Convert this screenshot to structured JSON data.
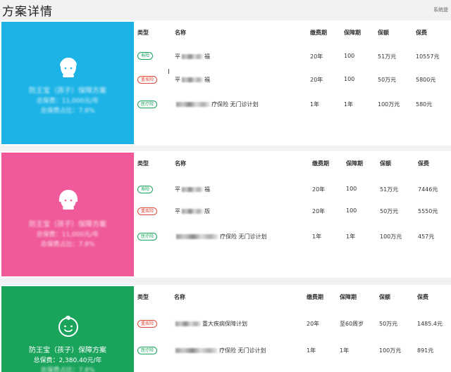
{
  "page": {
    "title": "方案详情",
    "corner": "系统提"
  },
  "columns": [
    "类型",
    "名称",
    "缴费期",
    "保障期",
    "保额",
    "保费"
  ],
  "cards": [
    {
      "panel": {
        "icon": "man-face-icon",
        "color": "#1db3e6",
        "line1": "防王宝（孩子）保障方案",
        "line2": "总保费：11,000元/年",
        "line3": "总保费占比：7.8%"
      },
      "rows": [
        {
          "type": "寿险",
          "type_class": "life",
          "name_pre": "平",
          "name_post": "福",
          "pay": "20年",
          "term": "100",
          "amount": "51万元",
          "premium": "10557元"
        },
        {
          "type": "重疾险",
          "type_class": "ci",
          "name_pre": "平",
          "name_post": "福",
          "pay": "20年",
          "term": "100",
          "amount": "50万元",
          "premium": "5800元"
        },
        {
          "type": "医疗险",
          "type_class": "med",
          "name_pre": "",
          "name_post": "疗保险 无门诊计划",
          "pay": "1年",
          "term": "1年",
          "amount": "100万元",
          "premium": "580元"
        }
      ]
    },
    {
      "panel": {
        "icon": "woman-face-icon",
        "color": "#f05a9a",
        "line1": "防王宝（孩子）保障方案",
        "line2": "总保费：11,000元/年",
        "line3": "总保费占比：7.8%"
      },
      "rows": [
        {
          "type": "寿险",
          "type_class": "life",
          "name_pre": "平",
          "name_post": "福",
          "pay": "20年",
          "term": "100",
          "amount": "51万元",
          "premium": "7446元"
        },
        {
          "type": "重疾险",
          "type_class": "ci",
          "name_pre": "平",
          "name_post": "版",
          "pay": "20年",
          "term": "100",
          "amount": "50万元",
          "premium": "5550元"
        },
        {
          "type": "医疗险",
          "type_class": "med",
          "name_pre": "",
          "name_post": "疗保险 无门诊计划",
          "pay": "1年",
          "term": "1年",
          "amount": "100万元",
          "premium": "457元"
        }
      ]
    },
    {
      "panel": {
        "icon": "baby-face-icon",
        "color": "#1aa35b",
        "line1": "防王宝（孩子）保障方案",
        "line2": "总保费：2,380.40元/年",
        "line3": "总保费占比：7.8%"
      },
      "rows": [
        {
          "type": "重疾险",
          "type_class": "ci",
          "name_pre": "",
          "name_post": "重大疾病保障计划",
          "pay": "20年",
          "term": "至60周岁",
          "amount": "50万元",
          "premium": "1485.4元"
        },
        {
          "type": "医疗险",
          "type_class": "med",
          "name_pre": "",
          "name_post": "疗保险 无门诊计划",
          "pay": "1年",
          "term": "1年",
          "amount": "100万元",
          "premium": "891元"
        }
      ]
    }
  ]
}
